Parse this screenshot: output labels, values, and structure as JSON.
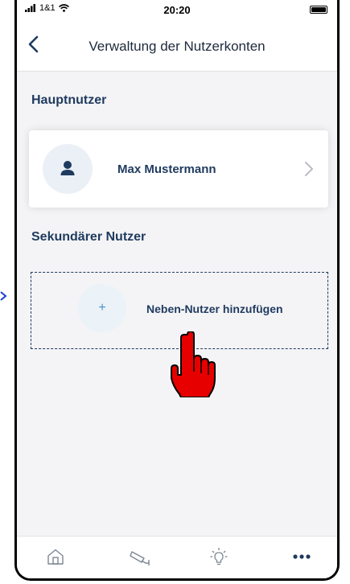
{
  "status_bar": {
    "carrier": "1&1",
    "time": "20:20"
  },
  "nav": {
    "title": "Verwaltung der Nutzerkonten",
    "back_icon": "chevron-left-icon"
  },
  "main_user": {
    "section_title": "Hauptnutzer",
    "name": "Max  Mustermann",
    "avatar_icon": "person-icon",
    "chevron_icon": "chevron-right-icon"
  },
  "secondary_user": {
    "section_title": "Sekundärer Nutzer",
    "add_symbol": "+",
    "add_label": "Neben-Nutzer hinzufügen"
  },
  "tabs": [
    {
      "icon": "home-icon"
    },
    {
      "icon": "camera-icon"
    },
    {
      "icon": "lightbulb-icon"
    },
    {
      "icon": "more-icon"
    }
  ],
  "colors": {
    "accent": "#1f3a5f",
    "background": "#f4f4f6",
    "hand_pointer": "#e00000"
  }
}
